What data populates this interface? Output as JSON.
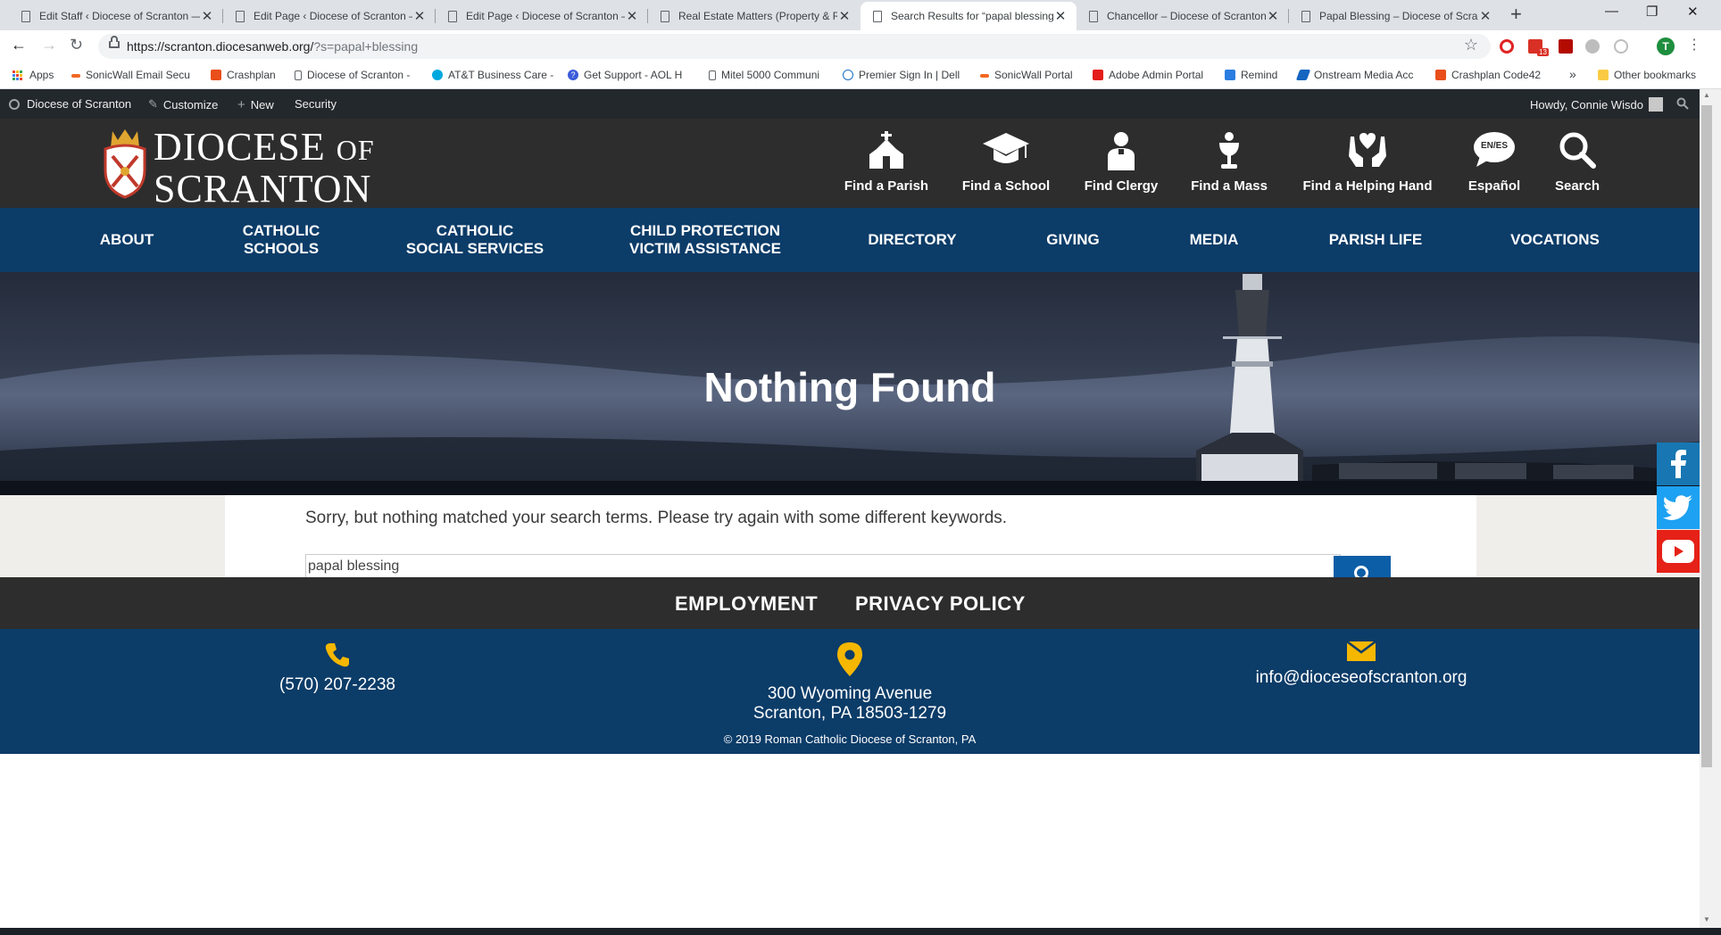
{
  "browser": {
    "tabs": [
      {
        "title": "Edit Staff ‹ Diocese of Scranton —",
        "active": false
      },
      {
        "title": "Edit Page ‹ Diocese of Scranton —",
        "active": false
      },
      {
        "title": "Edit Page ‹ Diocese of Scranton —",
        "active": false
      },
      {
        "title": "Real Estate Matters (Property & R",
        "active": false
      },
      {
        "title": "Search Results for “papal blessing",
        "active": true
      },
      {
        "title": "Chancellor – Diocese of Scranton",
        "active": false
      },
      {
        "title": "Papal Blessing – Diocese of Scran",
        "active": false
      }
    ],
    "url_base": "https://scranton.diocesanweb.org/",
    "url_query": "?s=papal+blessing",
    "profile_initial": "T",
    "gmail_badge": "13",
    "bookmarks": [
      {
        "label": "Apps",
        "color": "#ea4335"
      },
      {
        "label": "SonicWall Email Secu",
        "color": "#f26722"
      },
      {
        "label": "Crashplan",
        "color": "#e94e1b"
      },
      {
        "label": "Diocese of Scranton -",
        "color": "#ffffff"
      },
      {
        "label": "AT&T Business Care -",
        "color": "#00a8e0"
      },
      {
        "label": "Get Support - AOL H",
        "color": "#3a5bd9"
      },
      {
        "label": "Mitel 5000 Communi",
        "color": "#ffffff"
      },
      {
        "label": "Premier Sign In | Dell",
        "color": "#1b6ec2"
      },
      {
        "label": "SonicWall Portal",
        "color": "#f26722"
      },
      {
        "label": "Adobe Admin Portal",
        "color": "#e31d1a"
      },
      {
        "label": "Remind",
        "color": "#2a7de1"
      },
      {
        "label": "Onstream Media Acc",
        "color": "#1565c0"
      },
      {
        "label": "Crashplan Code42",
        "color": "#e94e1b"
      }
    ],
    "bookmarks_more": "»",
    "other_bookmarks": "Other bookmarks"
  },
  "admin_bar": {
    "site_name": "Diocese of Scranton",
    "customize": "Customize",
    "new": "New",
    "security": "Security",
    "howdy": "Howdy, Connie Wisdo"
  },
  "header": {
    "logo_line1": "DIOCESE",
    "logo_of": "OF",
    "logo_line2": "SCRANTON",
    "quick_links": [
      {
        "label": "Find a Parish",
        "icon": "church-icon"
      },
      {
        "label": "Find a School",
        "icon": "graduation-cap-icon"
      },
      {
        "label": "Find Clergy",
        "icon": "clergy-icon"
      },
      {
        "label": "Find a Mass",
        "icon": "chalice-icon"
      },
      {
        "label": "Find a Helping Hand",
        "icon": "helping-hand-icon"
      },
      {
        "label": "Español",
        "icon": "language-bubble-icon",
        "badge": "EN/ES"
      },
      {
        "label": "Search",
        "icon": "search-icon"
      }
    ]
  },
  "main_nav": [
    [
      "ABOUT"
    ],
    [
      "CATHOLIC",
      "SCHOOLS"
    ],
    [
      "CATHOLIC",
      "SOCIAL SERVICES"
    ],
    [
      "CHILD PROTECTION",
      "VICTIM ASSISTANCE"
    ],
    [
      "DIRECTORY"
    ],
    [
      "GIVING"
    ],
    [
      "MEDIA"
    ],
    [
      "PARISH LIFE"
    ],
    [
      "VOCATIONS"
    ]
  ],
  "hero": {
    "title": "Nothing Found"
  },
  "content": {
    "message": "Sorry, but nothing matched your search terms. Please try again with some different keywords.",
    "search_value": "papal blessing"
  },
  "footer": {
    "links": [
      "EMPLOYMENT",
      "PRIVACY POLICY"
    ],
    "phone": "(570) 207-2238",
    "address_line1": "300 Wyoming Avenue",
    "address_line2": "Scranton, PA 18503-1279",
    "email": "info@dioceseofscranton.org",
    "copyright": "© 2019 Roman Catholic Diocese of Scranton, PA"
  },
  "colors": {
    "navy": "#0c3c68",
    "charcoal": "#2d2d2d",
    "gold": "#f5b700",
    "facebook": "#1877b2",
    "twitter": "#1da1f2",
    "youtube": "#e62117"
  }
}
